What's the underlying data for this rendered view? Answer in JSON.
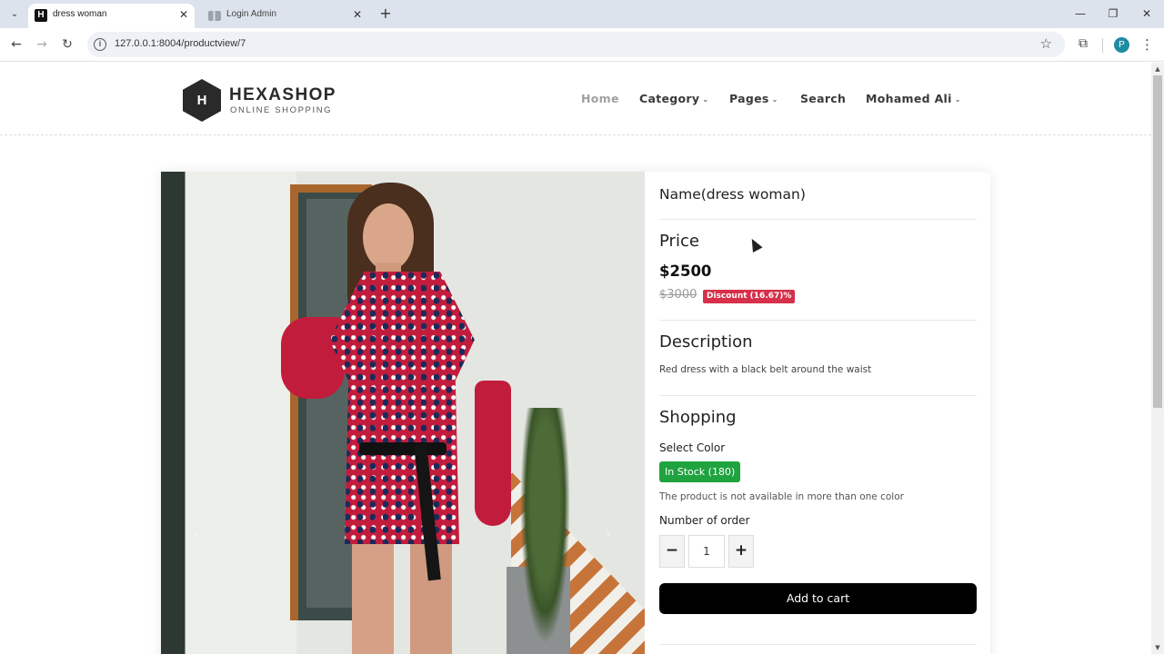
{
  "browser": {
    "tabs": [
      {
        "title": "dress woman",
        "active": true,
        "favicon": "H"
      },
      {
        "title": "Login Admin",
        "active": false
      }
    ],
    "url": "127.0.0.1:8004/productview/7",
    "profile_initial": "P"
  },
  "site": {
    "logo_letter": "H",
    "logo_name": "HEXASHOP",
    "logo_tagline": "ONLINE SHOPPING",
    "nav": [
      {
        "label": "Home",
        "dropdown": false
      },
      {
        "label": "Category",
        "dropdown": true
      },
      {
        "label": "Pages",
        "dropdown": true
      },
      {
        "label": "Search",
        "dropdown": false
      },
      {
        "label": "Mohamed Ali",
        "dropdown": true
      }
    ]
  },
  "product": {
    "name": "Name(dress woman)",
    "price_heading": "Price",
    "price": "$2500",
    "old_price": "$3000",
    "discount": "Discount (16.67)%",
    "description_heading": "Description",
    "description": "Red dress with a black belt around the waist",
    "shopping_heading": "Shopping",
    "select_color_label": "Select Color",
    "stock_badge": "In Stock (180)",
    "color_note": "The product is not available in more than one color",
    "quantity_label": "Number of order",
    "quantity": "1",
    "minus": "−",
    "plus": "+",
    "add_to_cart": "Add to cart"
  },
  "colors": {
    "discount_badge": "#d6304a",
    "stock_badge": "#1fa33f",
    "add_to_cart": "#000000"
  }
}
